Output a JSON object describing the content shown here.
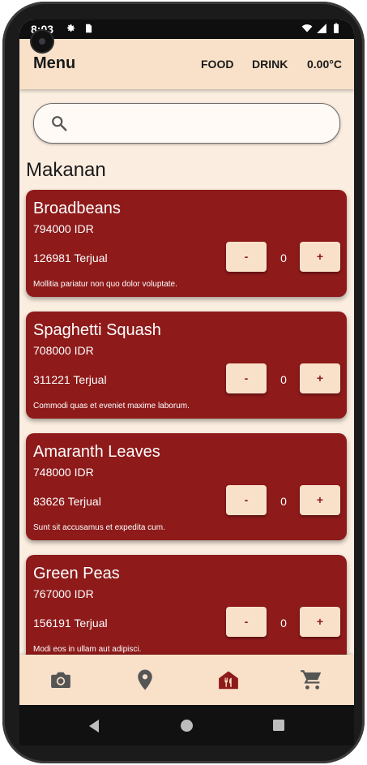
{
  "status_bar": {
    "time": "8:03"
  },
  "appbar": {
    "title": "Menu",
    "nav": [
      "FOOD",
      "DRINK",
      "0.00°C"
    ]
  },
  "search": {
    "value": "",
    "icon": "search-icon"
  },
  "section_title": "Makanan",
  "items": [
    {
      "name": "Broadbeans",
      "price": "794000 IDR",
      "sold": "126981 Terjual",
      "qty": "0",
      "minus": "-",
      "plus": "+",
      "desc": "Mollitia pariatur non quo dolor voluptate."
    },
    {
      "name": "Spaghetti Squash",
      "price": "708000 IDR",
      "sold": "311221 Terjual",
      "qty": "0",
      "minus": "-",
      "plus": "+",
      "desc": "Commodi quas et eveniet maxime laborum."
    },
    {
      "name": "Amaranth Leaves",
      "price": "748000 IDR",
      "sold": "83626 Terjual",
      "qty": "0",
      "minus": "-",
      "plus": "+",
      "desc": "Sunt sit accusamus et expedita cum."
    },
    {
      "name": "Green Peas",
      "price": "767000 IDR",
      "sold": "156191 Terjual",
      "qty": "0",
      "minus": "-",
      "plus": "+",
      "desc": "Modi eos in ullam aut adipisci."
    }
  ],
  "bottom_nav": {
    "icons": [
      "camera-icon",
      "location-pin-icon",
      "restaurant-icon",
      "cart-icon"
    ],
    "active": "restaurant-icon"
  },
  "colors": {
    "card": "#8e1a1a",
    "cream": "#f9e1c9",
    "background": "#fbeee0",
    "icon": "#555555"
  }
}
